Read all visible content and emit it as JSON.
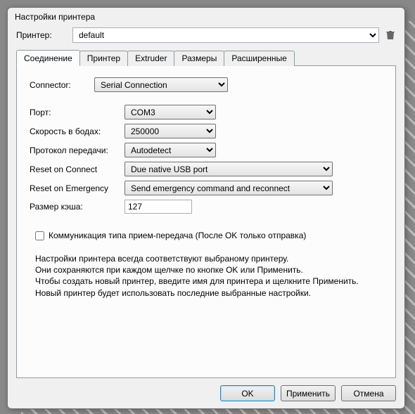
{
  "window": {
    "title": "Настройки принтера"
  },
  "printer": {
    "label": "Принтер:",
    "value": "default"
  },
  "tabs": [
    {
      "label": "Соединение"
    },
    {
      "label": "Принтер"
    },
    {
      "label": "Extruder"
    },
    {
      "label": "Размеры"
    },
    {
      "label": "Расширенные"
    }
  ],
  "conn": {
    "connector_label": "Connector:",
    "connector_value": "Serial Connection",
    "port_label": "Порт:",
    "port_value": "COM3",
    "baud_label": "Скорость в бодах:",
    "baud_value": "250000",
    "protocol_label": "Протокол передачи:",
    "protocol_value": "Autodetect",
    "reset_connect_label": "Reset on Connect",
    "reset_connect_value": "Due native USB port",
    "reset_emergency_label": "Reset on Emergency",
    "reset_emergency_value": "Send emergency command and reconnect",
    "cache_label": "Размер кэша:",
    "cache_value": "127",
    "pingpong_label": "Коммуникация типа прием-передача (После OK только отправка)"
  },
  "help": {
    "l1": "Настройки принтера всегда соответствуют выбраному принтеру.",
    "l2": "Они сохраняются при каждом щелчке по кнопке OK или Применить.",
    "l3": "Чтобы создать новый принтер, введите имя для принтера и щелкните Применить.",
    "l4": "Новый принтер будет использовать последние выбранные настройки."
  },
  "buttons": {
    "ok": "OK",
    "apply": "Применить",
    "cancel": "Отмена"
  }
}
